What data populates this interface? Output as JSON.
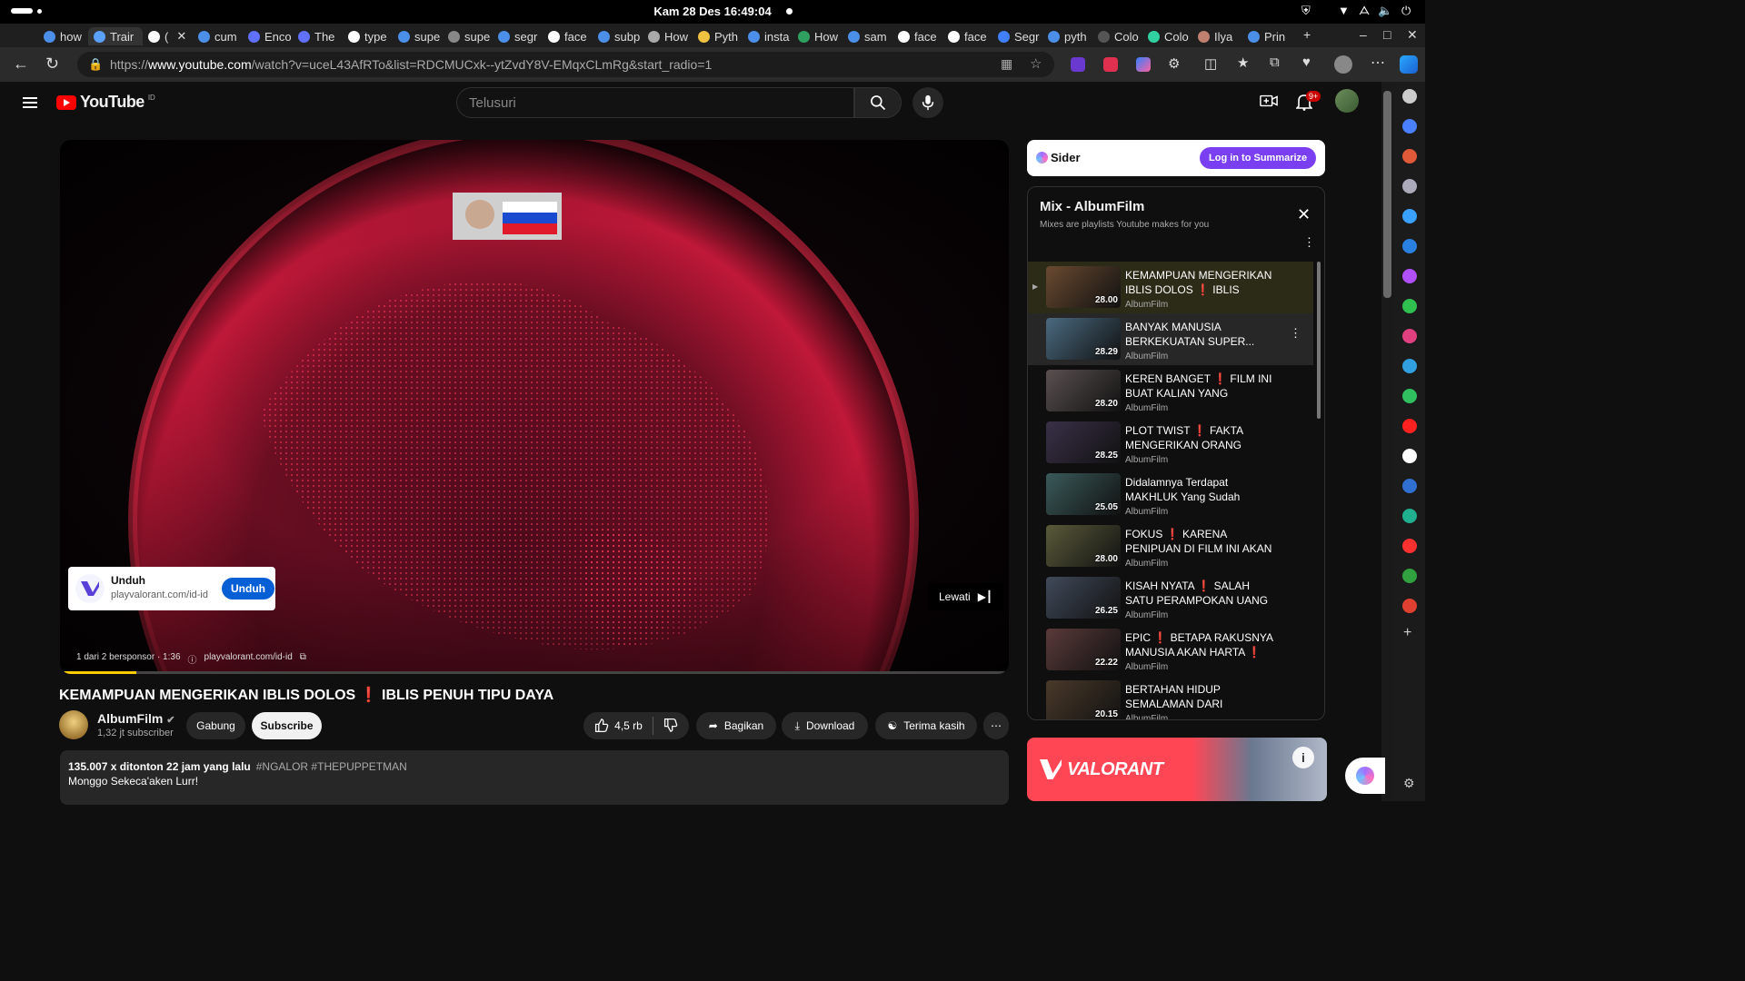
{
  "os": {
    "clock": "Kam 28 Des  16:49:04"
  },
  "tabs": [
    {
      "label": "how",
      "color": "#4b8fe8",
      "icon": "search-icon"
    },
    {
      "label": "Trair",
      "color": "#5aa0ff",
      "icon": "flutter-icon"
    },
    {
      "label": "(",
      "color": "#ffffff",
      "icon": "speaker-icon"
    },
    {
      "label": "cum",
      "color": "#4b8fe8",
      "icon": "search-icon"
    },
    {
      "label": "Enco",
      "color": "#6070ff",
      "icon": "site-icon"
    },
    {
      "label": "The",
      "color": "#6070ff",
      "icon": "site-icon"
    },
    {
      "label": "type",
      "color": "#ffffff",
      "icon": "github-icon"
    },
    {
      "label": "supe",
      "color": "#4b8fe8",
      "icon": "search-icon"
    },
    {
      "label": "supe",
      "color": "#888888",
      "icon": "site-icon"
    },
    {
      "label": "segr",
      "color": "#4b8fe8",
      "icon": "search-icon"
    },
    {
      "label": "face",
      "color": "#ffffff",
      "icon": "github-icon"
    },
    {
      "label": "subp",
      "color": "#4b8fe8",
      "icon": "search-icon"
    },
    {
      "label": "How",
      "color": "#aaaaaa",
      "icon": "site-icon"
    },
    {
      "label": "Pyth",
      "color": "#f0c040",
      "icon": "site-icon"
    },
    {
      "label": "insta",
      "color": "#4b8fe8",
      "icon": "search-icon"
    },
    {
      "label": "How",
      "color": "#30a060",
      "icon": "site-icon"
    },
    {
      "label": "sam",
      "color": "#4b8fe8",
      "icon": "search-icon"
    },
    {
      "label": "face",
      "color": "#ffffff",
      "icon": "github-icon"
    },
    {
      "label": "face",
      "color": "#ffffff",
      "icon": "github-icon"
    },
    {
      "label": "Segr",
      "color": "#4080ff",
      "icon": "meta-icon"
    },
    {
      "label": "pyth",
      "color": "#4b8fe8",
      "icon": "search-icon"
    },
    {
      "label": "Colo",
      "color": "#555555",
      "icon": "site-icon"
    },
    {
      "label": "Colo",
      "color": "#30d0a0",
      "icon": "site-icon"
    },
    {
      "label": "Ilya",
      "color": "#c08070",
      "icon": "site-icon"
    },
    {
      "label": "Prin",
      "color": "#4b8fe8",
      "icon": "site-icon"
    }
  ],
  "address": {
    "url_prefix": "https://",
    "url_host": "www.youtube.com",
    "url_path": "/watch?v=uceL43AfRTo&list=RDCMUCxk--ytZvdY8V-EMqxCLmRg&start_radio=1"
  },
  "youtube": {
    "logo_text": "YouTube",
    "country": "ID",
    "search_placeholder": "Telusuri",
    "notification_count": "9+"
  },
  "player": {
    "ad_card": {
      "title": "Unduh",
      "domain": "playvalorant.com/id-id",
      "button": "Unduh"
    },
    "skip_label": "Lewati",
    "ad_info": "1 dari 2 bersponsor · 1:36",
    "ad_link": "playvalorant.com/id-id",
    "ad_progress": 0.08
  },
  "video": {
    "title": "KEMAMPUAN MENGERIKAN IBLIS DOLOS ❗ IBLIS PENUH TIPU DAYA",
    "channel": "AlbumFilm",
    "subscribers": "1,32 jt subscriber",
    "join_label": "Gabung",
    "subscribe_label": "Subscribe",
    "likes": "4,5 rb",
    "share_label": "Bagikan",
    "download_label": "Download",
    "thanks_label": "Terima kasih",
    "views": "135.007 x ditonton  22 jam yang lalu",
    "hashtags": "#NGALOR #THEPUPPETMAN",
    "description": "Monggo Sekeca'aken Lurr!"
  },
  "sider": {
    "name": "Sider",
    "button": "Log in to Summarize"
  },
  "playlist": {
    "title": "Mix - AlbumFilm",
    "subtitle": "Mixes are playlists Youtube makes for you",
    "items": [
      {
        "title": "KEMAMPUAN MENGERIKAN IBLIS DOLOS ❗ IBLIS PENUH...",
        "author": "AlbumFilm",
        "duration": "28.00",
        "thumb": "#6a4a30",
        "current": true
      },
      {
        "title": "BANYAK MANUSIA BERKEKUATAN SUPER...",
        "author": "AlbumFilm",
        "duration": "28.29",
        "thumb": "#4a6a80",
        "hover": true
      },
      {
        "title": "KEREN BANGET ❗ FILM INI BUAT KALIAN YANG MERAS...",
        "author": "AlbumFilm",
        "duration": "28.20",
        "thumb": "#5a5050"
      },
      {
        "title": "PLOT TWIST ❗ FAKTA MENGERIKAN ORANG TUA...",
        "author": "AlbumFilm",
        "duration": "28.25",
        "thumb": "#3a3048"
      },
      {
        "title": "Didalamnya Terdapat MAKHLUK Yang Sudah Hidup...",
        "author": "AlbumFilm",
        "duration": "25.05",
        "thumb": "#3a5a5a"
      },
      {
        "title": "FOKUS ❗ KARENA PENIPUAN DI FILM INI AKAN MEMBUAT...",
        "author": "AlbumFilm",
        "duration": "28.00",
        "thumb": "#5a5a3a"
      },
      {
        "title": "KISAH NYATA ❗ SALAH SATU PERAMPOKAN UANG TUNAI...",
        "author": "AlbumFilm",
        "duration": "26.25",
        "thumb": "#404a5a"
      },
      {
        "title": "EPIC ❗ BETAPA RAKUSNYA MANUSIA AKAN HARTA ❗",
        "author": "AlbumFilm",
        "duration": "22.22",
        "thumb": "#5a3a3a"
      },
      {
        "title": "BERTAHAN HIDUP SEMALAMAN DARI HARIMA...",
        "author": "AlbumFilm",
        "duration": "20.15",
        "thumb": "#4a3a2a"
      }
    ]
  },
  "banner": {
    "brand": "VALORANT",
    "accent": "#ff4655"
  },
  "colors": {
    "subscribe_bg": "#f1f1f1",
    "yt_red": "#ff0000",
    "link_blue": "#065fd4"
  }
}
